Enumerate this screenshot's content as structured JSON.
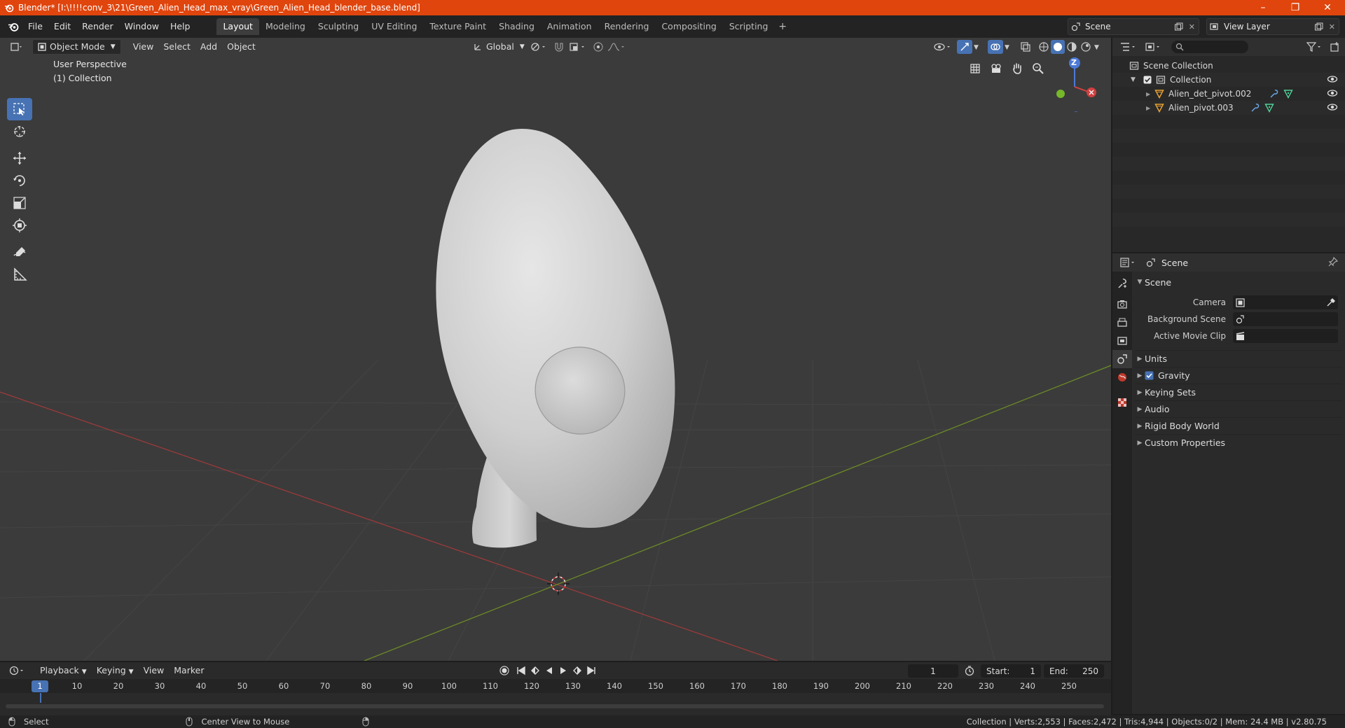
{
  "title": "Blender* [I:\\!!!!conv_3\\21\\Green_Alien_Head_max_vray\\Green_Alien_Head_blender_base.blend]",
  "window_controls": [
    "–",
    "❐",
    "✕"
  ],
  "menus": [
    "File",
    "Edit",
    "Render",
    "Window",
    "Help"
  ],
  "workspaces": [
    "Layout",
    "Modeling",
    "Sculpting",
    "UV Editing",
    "Texture Paint",
    "Shading",
    "Animation",
    "Rendering",
    "Compositing",
    "Scripting"
  ],
  "workspace_plus": "+",
  "scene_name": "Scene",
  "view_layer": "View Layer",
  "viewport": {
    "mode": "Object Mode",
    "menus": [
      "View",
      "Select",
      "Add",
      "Object"
    ],
    "transform": "Global",
    "perspective": "User Perspective",
    "collection": "(1) Collection",
    "gizmo_z": "Z",
    "colors": {
      "background": "#3b3b3b",
      "x_axis": "#9b3a3a",
      "y_axis": "#6c8a26",
      "grid": "#444444"
    }
  },
  "outliner": {
    "root": "Scene Collection",
    "collection": "Collection",
    "objects": [
      "Alien_det_pivot.002",
      "Alien_pivot.003"
    ]
  },
  "properties": {
    "header": "Scene",
    "panel": "Scene",
    "fields": [
      {
        "label": "Camera"
      },
      {
        "label": "Background Scene"
      },
      {
        "label": "Active Movie Clip"
      }
    ],
    "subpanels": [
      "Units",
      "Gravity",
      "Keying Sets",
      "Audio",
      "Rigid Body World",
      "Custom Properties"
    ]
  },
  "timeline": {
    "menus": [
      "Playback",
      "Keying",
      "View",
      "Marker"
    ],
    "current_frame": "1",
    "start_label": "Start:",
    "start": "1",
    "end_label": "End:",
    "end": "250",
    "ticks": [
      "1",
      "10",
      "20",
      "30",
      "40",
      "50",
      "60",
      "70",
      "80",
      "90",
      "100",
      "110",
      "120",
      "130",
      "140",
      "150",
      "160",
      "170",
      "180",
      "190",
      "200",
      "210",
      "220",
      "230",
      "240",
      "250"
    ]
  },
  "status": {
    "left_action": "Select",
    "mid_action": "Center View to Mouse",
    "stats": "Collection | Verts:2,553 | Faces:2,472 | Tris:4,944 | Objects:0/2 | Mem: 24.4 MB | v2.80.75"
  },
  "accent": "#4772b3",
  "titlebar_color": "#e0450d"
}
